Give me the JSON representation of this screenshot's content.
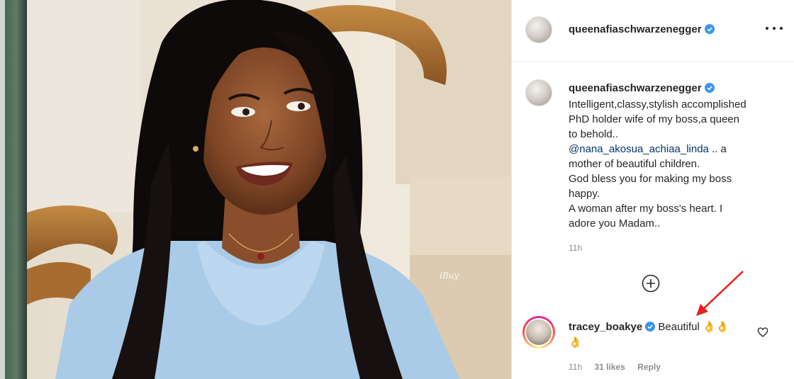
{
  "post": {
    "author": {
      "username": "queenafiaschwarzenegger",
      "verified": true,
      "avatar_icon": "profile-photo"
    },
    "photo": {
      "watermark": "iBuy"
    },
    "caption": {
      "lines": [
        "Intelligent,classy,stylish accomplished",
        "PhD holder wife of my boss,a queen",
        "to behold..",
        "@nana_akosua_achiaa_linda",
        " .. a",
        "mother of beautiful children.",
        "God bless you for making my boss",
        "happy.",
        "A woman after my boss's heart. I",
        "adore you Madam.."
      ],
      "time": "11h"
    },
    "load_more_icon": "plus-circle-icon",
    "comment": {
      "username": "tracey_boakye",
      "verified": true,
      "text": "Beautiful",
      "emoji_line1": "👌👌",
      "emoji_line2": "👌",
      "time": "11h",
      "likes": "31 likes",
      "reply": "Reply",
      "like_icon": "heart-outline-icon"
    },
    "more_options_icon": "ellipsis-icon",
    "annotation": {
      "arrow_color": "#e8201a"
    },
    "colors": {
      "verified_blue": "#3897f0",
      "mention_blue": "#00376b",
      "secondary_text": "#8e8e8e",
      "primary_text": "#262626"
    }
  }
}
